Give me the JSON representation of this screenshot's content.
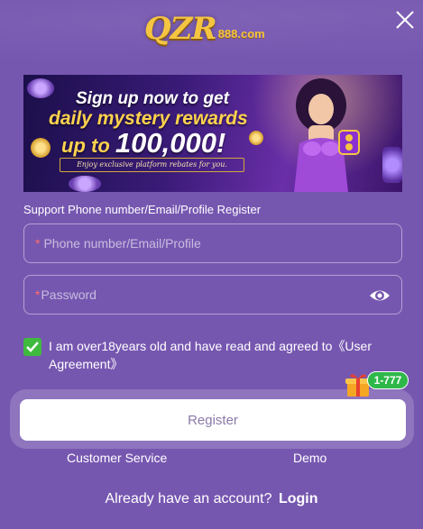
{
  "header": {
    "logo_main": "QZR",
    "logo_suffix": "888.com",
    "close_icon": "close-icon"
  },
  "banner": {
    "line1": "Sign up now to get",
    "line2": "daily mystery rewards",
    "line3_prefix": "up to ",
    "line3_amount": "100,000!",
    "tagline": "Enjoy exclusive platform rebates for you."
  },
  "form": {
    "section_label": "Support Phone number/Email/Profile Register",
    "phone_required_mark": "*",
    "phone_placeholder": "Phone number/Email/Profile",
    "password_required_mark": "*",
    "password_placeholder": "Password",
    "eye_icon": "eye-icon",
    "agreement_text": "I am over18years old and have read and agreed to",
    "agreement_link": "《User Agreement》",
    "agreement_checked": true,
    "register_label": "Register"
  },
  "promo": {
    "badge": "1-777",
    "icon": "gift-icon"
  },
  "footer": {
    "customer_service": "Customer Service",
    "demo": "Demo",
    "login_prompt": "Already have an account?",
    "login_link": "Login"
  },
  "colors": {
    "background": "#7657b0",
    "accent_gold": "#f5c542",
    "check_green": "#3fba3f",
    "badge_green": "#2fb84a",
    "required_red": "#ff6b6b"
  }
}
